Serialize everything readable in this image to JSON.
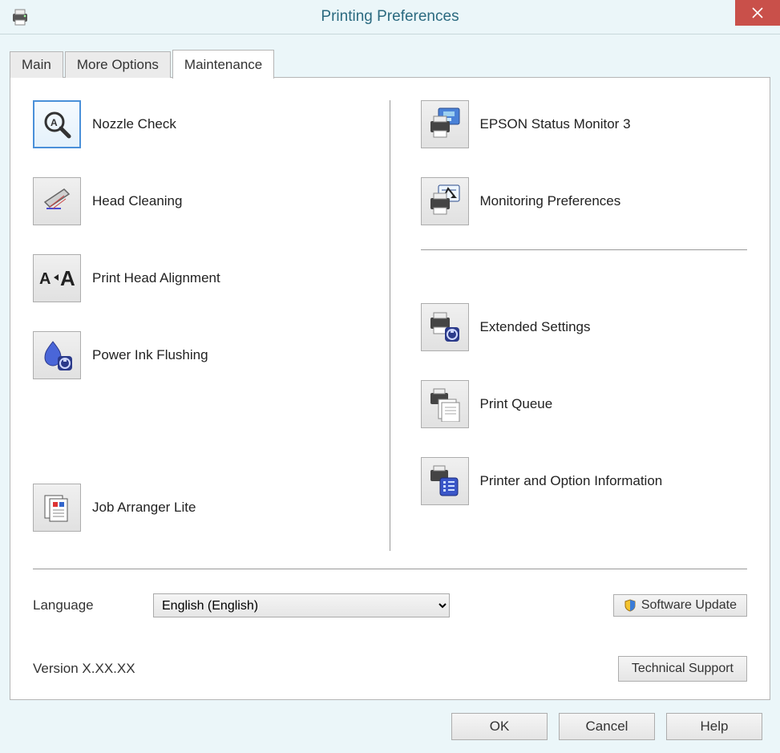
{
  "titlebar": {
    "title": "Printing Preferences"
  },
  "tabs": {
    "main": "Main",
    "more_options": "More Options",
    "maintenance": "Maintenance"
  },
  "tools_left": {
    "nozzle_check": "Nozzle Check",
    "head_cleaning": "Head Cleaning",
    "head_alignment": "Print Head Alignment",
    "power_ink_flushing": "Power Ink Flushing",
    "job_arranger": "Job Arranger Lite"
  },
  "tools_right": {
    "status_monitor": "EPSON Status Monitor 3",
    "monitoring_prefs": "Monitoring Preferences",
    "extended_settings": "Extended Settings",
    "print_queue": "Print Queue",
    "printer_info": "Printer and Option Information"
  },
  "footer": {
    "language_label": "Language",
    "language_value": "English (English)",
    "software_update": "Software Update",
    "version": "Version  X.XX.XX",
    "technical_support": "Technical Support"
  },
  "buttons": {
    "ok": "OK",
    "cancel": "Cancel",
    "help": "Help"
  }
}
